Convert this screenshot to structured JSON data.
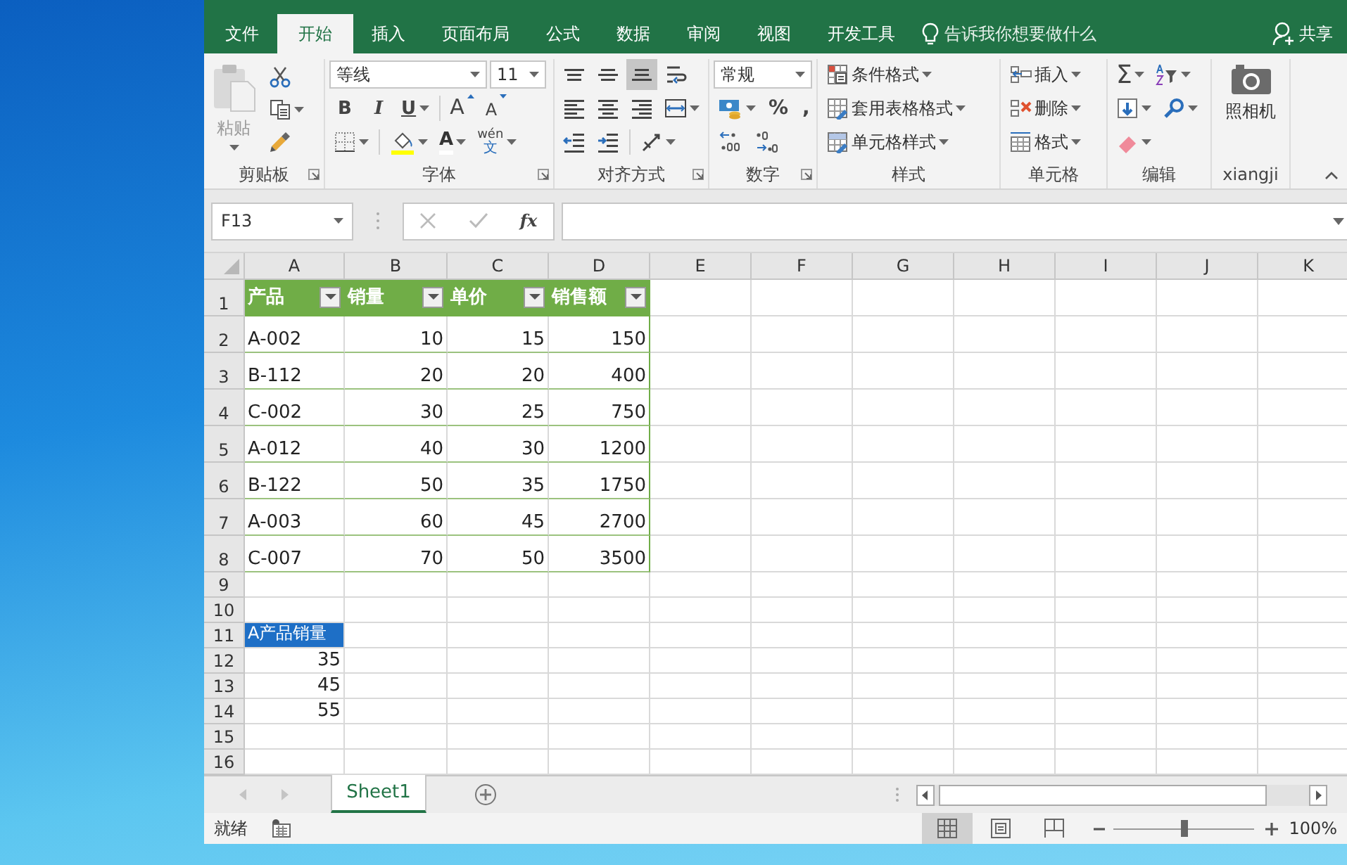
{
  "ribbon_tabs": [
    {
      "label": "文件",
      "selected": false
    },
    {
      "label": "开始",
      "selected": true
    },
    {
      "label": "插入",
      "selected": false
    },
    {
      "label": "页面布局",
      "selected": false
    },
    {
      "label": "公式",
      "selected": false
    },
    {
      "label": "数据",
      "selected": false
    },
    {
      "label": "审阅",
      "selected": false
    },
    {
      "label": "视图",
      "selected": false
    },
    {
      "label": "开发工具",
      "selected": false
    }
  ],
  "tell_me": {
    "placeholder": "告诉我你想要做什么"
  },
  "share": "共享",
  "clipboard": {
    "label": "剪贴板",
    "paste": "粘贴"
  },
  "font": {
    "label": "字体",
    "font_name": "等线",
    "font_size": "11",
    "bold": "B",
    "italic": "I",
    "underline": "U",
    "grow": "A",
    "shrink": "A",
    "font_color": "A",
    "phonetic_top": "wén",
    "phonetic_bottom": "文"
  },
  "alignment": {
    "label": "对齐方式",
    "rows": [
      [
        {
          "kind": "top",
          "selected": false
        },
        {
          "kind": "middle",
          "selected": false
        },
        {
          "kind": "bottom",
          "selected": true
        },
        {
          "kind": "wrap",
          "selected": false
        }
      ],
      [
        {
          "kind": "left",
          "selected": false
        },
        {
          "kind": "center",
          "selected": false
        },
        {
          "kind": "right",
          "selected": false
        },
        {
          "kind": "merge",
          "selected": false
        }
      ],
      [
        {
          "kind": "outdent",
          "selected": false
        },
        {
          "kind": "indent",
          "selected": false
        },
        {
          "kind": "orientation",
          "selected": false
        }
      ]
    ]
  },
  "number": {
    "label": "数字",
    "format": "常规",
    "percent": "%",
    "comma": ","
  },
  "styles": {
    "label": "样式",
    "buttons": [
      {
        "kind": "conditional",
        "label": "条件格式"
      },
      {
        "kind": "table",
        "label": "套用表格格式"
      },
      {
        "kind": "cellstyle",
        "label": "单元格样式"
      }
    ]
  },
  "cells": {
    "label": "单元格",
    "buttons": [
      {
        "kind": "insert",
        "label": "插入"
      },
      {
        "kind": "delete",
        "label": "删除"
      },
      {
        "kind": "format",
        "label": "格式"
      }
    ]
  },
  "editing": {
    "label": "编辑",
    "autosum": "Σ"
  },
  "camera": {
    "label": "xiangji",
    "button": "照相机"
  },
  "name_box": {
    "value": "F13"
  },
  "formula_bar": {
    "fx": "fx"
  },
  "grid": {
    "columns": [
      "A",
      "B",
      "C",
      "D",
      "E",
      "F",
      "G",
      "H",
      "I",
      "J",
      "K"
    ],
    "rows": [
      {
        "header": "1",
        "cells": [
          {
            "kind": "table_header",
            "text": "产品"
          },
          {
            "kind": "table_header",
            "text": "销量"
          },
          {
            "kind": "table_header",
            "text": "单价"
          },
          {
            "kind": "table_header",
            "text": "销售额"
          }
        ]
      },
      {
        "header": "2",
        "cells": [
          {
            "kind": "table_text",
            "text": "A-002"
          },
          {
            "kind": "table_number",
            "text": "10"
          },
          {
            "kind": "table_number",
            "text": "15"
          },
          {
            "kind": "table_number",
            "text": "150"
          }
        ]
      },
      {
        "header": "3",
        "cells": [
          {
            "kind": "table_text",
            "text": "B-112"
          },
          {
            "kind": "table_number",
            "text": "20"
          },
          {
            "kind": "table_number",
            "text": "20"
          },
          {
            "kind": "table_number",
            "text": "400"
          }
        ]
      },
      {
        "header": "4",
        "cells": [
          {
            "kind": "table_text",
            "text": "C-002"
          },
          {
            "kind": "table_number",
            "text": "30"
          },
          {
            "kind": "table_number",
            "text": "25"
          },
          {
            "kind": "table_number",
            "text": "750"
          }
        ]
      },
      {
        "header": "5",
        "cells": [
          {
            "kind": "table_text",
            "text": "A-012"
          },
          {
            "kind": "table_number",
            "text": "40"
          },
          {
            "kind": "table_number",
            "text": "30"
          },
          {
            "kind": "table_number",
            "text": "1200"
          }
        ]
      },
      {
        "header": "6",
        "cells": [
          {
            "kind": "table_text",
            "text": "B-122"
          },
          {
            "kind": "table_number",
            "text": "50"
          },
          {
            "kind": "table_number",
            "text": "35"
          },
          {
            "kind": "table_number",
            "text": "1750"
          }
        ]
      },
      {
        "header": "7",
        "cells": [
          {
            "kind": "table_text",
            "text": "A-003"
          },
          {
            "kind": "table_number",
            "text": "60"
          },
          {
            "kind": "table_number",
            "text": "45"
          },
          {
            "kind": "table_number",
            "text": "2700"
          }
        ]
      },
      {
        "header": "8",
        "cells": [
          {
            "kind": "table_text",
            "text": "C-007"
          },
          {
            "kind": "table_number",
            "text": "70"
          },
          {
            "kind": "table_number",
            "text": "50"
          },
          {
            "kind": "table_number",
            "text": "3500"
          }
        ]
      },
      {
        "header": "9"
      },
      {
        "header": "10"
      },
      {
        "header": "11",
        "cells": [
          {
            "kind": "highlight",
            "text": "A产品销量"
          }
        ]
      },
      {
        "header": "12",
        "cells": [
          {
            "kind": "number",
            "text": "35"
          }
        ]
      },
      {
        "header": "13",
        "cells": [
          {
            "kind": "number",
            "text": "45"
          }
        ]
      },
      {
        "header": "14",
        "cells": [
          {
            "kind": "number",
            "text": "55"
          }
        ]
      },
      {
        "header": "15"
      },
      {
        "header": "16"
      }
    ]
  },
  "sheet_tabs": [
    {
      "label": "Sheet1",
      "selected": true
    }
  ],
  "status": "就绪",
  "view_buttons": [
    {
      "kind": "normal",
      "selected": true
    },
    {
      "kind": "page_layout",
      "selected": false
    },
    {
      "kind": "page_break",
      "selected": false
    }
  ],
  "zoom": {
    "level": 0.5,
    "reading": "100%"
  }
}
